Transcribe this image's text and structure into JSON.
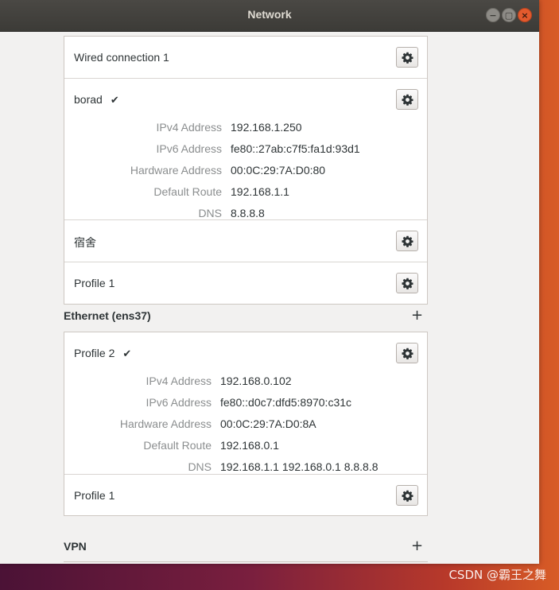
{
  "window": {
    "title": "Network",
    "controls": {
      "minimize": "−",
      "maximize": "▢",
      "close": "×"
    }
  },
  "connections_top": [
    {
      "name": "Wired connection 1",
      "active": false
    },
    {
      "name": "borad",
      "active": true,
      "check": "✔",
      "details": [
        {
          "label": "IPv4 Address",
          "value": "192.168.1.250"
        },
        {
          "label": "IPv6 Address",
          "value": "fe80::27ab:c7f5:fa1d:93d1"
        },
        {
          "label": "Hardware Address",
          "value": "00:0C:29:7A:D0:80"
        },
        {
          "label": "Default Route",
          "value": "192.168.1.1"
        },
        {
          "label": "DNS",
          "value": "8.8.8.8"
        }
      ]
    },
    {
      "name": "宿舍",
      "active": false
    },
    {
      "name": "Profile 1",
      "active": false
    }
  ],
  "ethernet_section": {
    "title": "Ethernet (ens37)",
    "add_label": "+"
  },
  "connections_ethernet": [
    {
      "name": "Profile 2",
      "active": true,
      "check": "✔",
      "details": [
        {
          "label": "IPv4 Address",
          "value": "192.168.0.102"
        },
        {
          "label": "IPv6 Address",
          "value": "fe80::d0c7:dfd5:8970:c31c"
        },
        {
          "label": "Hardware Address",
          "value": "00:0C:29:7A:D0:8A"
        },
        {
          "label": "Default Route",
          "value": "192.168.0.1"
        },
        {
          "label": "DNS",
          "value": "192.168.1.1 192.168.0.1 8.8.8.8"
        }
      ]
    },
    {
      "name": "Profile 1",
      "active": false
    }
  ],
  "vpn_section": {
    "title": "VPN",
    "add_label": "+"
  },
  "icons": {
    "settings": "gear-icon",
    "add": "plus-icon",
    "active": "checkmark-icon"
  },
  "watermark": "CSDN @霸王之舞",
  "colors": {
    "accent_close": "#e35a2d",
    "titlebar": "#3c3b37",
    "background": "#f2f1f0"
  }
}
